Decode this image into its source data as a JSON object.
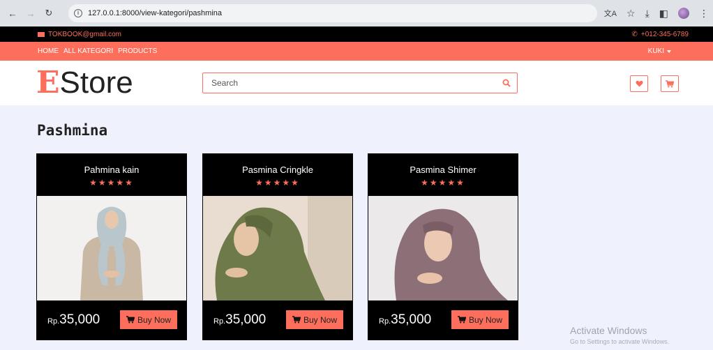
{
  "browser": {
    "url": "127.0.0.1:8000/view-kategori/pashmina"
  },
  "topbar": {
    "email": "TOKBOOK@gmail.com",
    "phone": "+012-345-6789",
    "accent": "#fd6f5c"
  },
  "nav": {
    "links": [
      "HOME",
      "ALL KATEGORI",
      "PRODUCTS"
    ],
    "user": "KUKI"
  },
  "header": {
    "logo_first": "E",
    "logo_rest": "Store",
    "search_placeholder": "Search"
  },
  "page": {
    "title": "Pashmina"
  },
  "products": [
    {
      "name": "Pahmina kain",
      "stars": "★★★★★",
      "currency": "Rp.",
      "price": "35,000",
      "buy_label": "Buy Now",
      "image": "beige-hijab-photo"
    },
    {
      "name": "Pasmina Cringkle",
      "stars": "★★★★★",
      "currency": "Rp.",
      "price": "35,000",
      "buy_label": "Buy Now",
      "image": "olive-hijab-photo"
    },
    {
      "name": "Pasmina Shimer",
      "stars": "★★★★★",
      "currency": "Rp.",
      "price": "35,000",
      "buy_label": "Buy Now",
      "image": "mauve-hijab-photo"
    }
  ],
  "watermark": {
    "line1": "Activate Windows",
    "line2": "Go to Settings to activate Windows."
  }
}
